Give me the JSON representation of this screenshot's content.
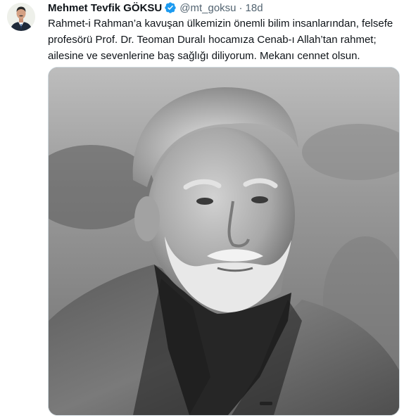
{
  "tweet": {
    "author_name": "Mehmet Tevfik GÖKSU",
    "handle": "@mt_goksu",
    "separator": "·",
    "time": "18d",
    "text_lines": [
      "Rahmet-i Rahman’a kavuşan ülkemizin önemli bilim insanlarından, felsefe",
      "profesörü Prof. Dr. Teoman Duralı hocamıza Cenab-ı Allah’tan rahmet;",
      "ailesine ve sevenlerine baş sağlığı diliyorum. Mekanı cennet olsun."
    ],
    "verified_icon": "verified-badge-icon",
    "verified_color": "#1d9bf0"
  }
}
